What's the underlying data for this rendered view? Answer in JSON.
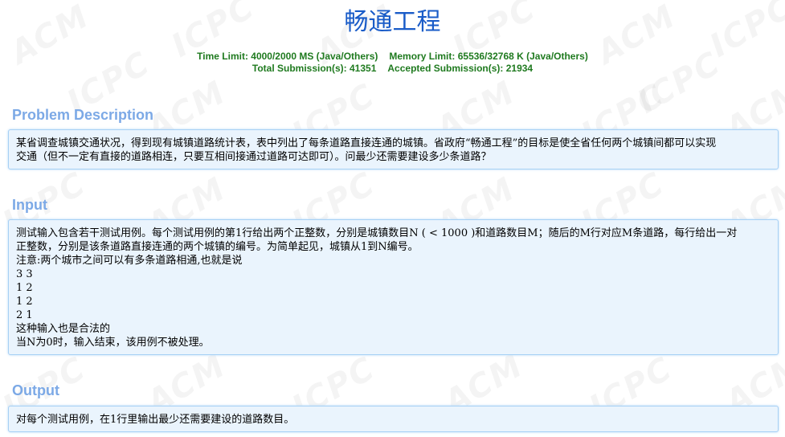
{
  "problem": {
    "title": "畅通工程",
    "stats": {
      "time_limit": "Time Limit: 4000/2000 MS (Java/Others)",
      "memory_limit": "Memory Limit: 65536/32768 K (Java/Others)",
      "total_submissions": "Total Submission(s): 41351",
      "accepted_submissions": "Accepted Submission(s): 21934"
    },
    "watermark_text": "ACM ICPC"
  },
  "sections": {
    "description": {
      "heading": "Problem Description",
      "lines": [
        "某省调查城镇交通状况，得到现有城镇道路统计表，表中列出了每条道路直接连通的城镇。省政府“畅通工程”的目标是使全省任何两个城镇间都可以实现",
        "交通（但不一定有直接的道路相连，只要互相间接通过道路可达即可）。问最少还需要建设多少条道路？"
      ]
    },
    "input": {
      "heading": "Input",
      "lines": [
        "测试输入包含若干测试用例。每个测试用例的第1行给出两个正整数，分别是城镇数目N ( < 1000 )和道路数目M；随后的M行对应M条道路，每行给出一对",
        "正整数，分别是该条道路直接连通的两个城镇的编号。为简单起见，城镇从1到N编号。",
        "注意:两个城市之间可以有多条道路相通,也就是说",
        "3 3",
        "1 2",
        "1 2",
        "2 1",
        "这种输入也是合法的",
        "当N为0时，输入结束，该用例不被处理。"
      ]
    },
    "output": {
      "heading": "Output",
      "lines": [
        "对每个测试用例，在1行里输出最少还需要建设的道路数目。"
      ]
    }
  }
}
